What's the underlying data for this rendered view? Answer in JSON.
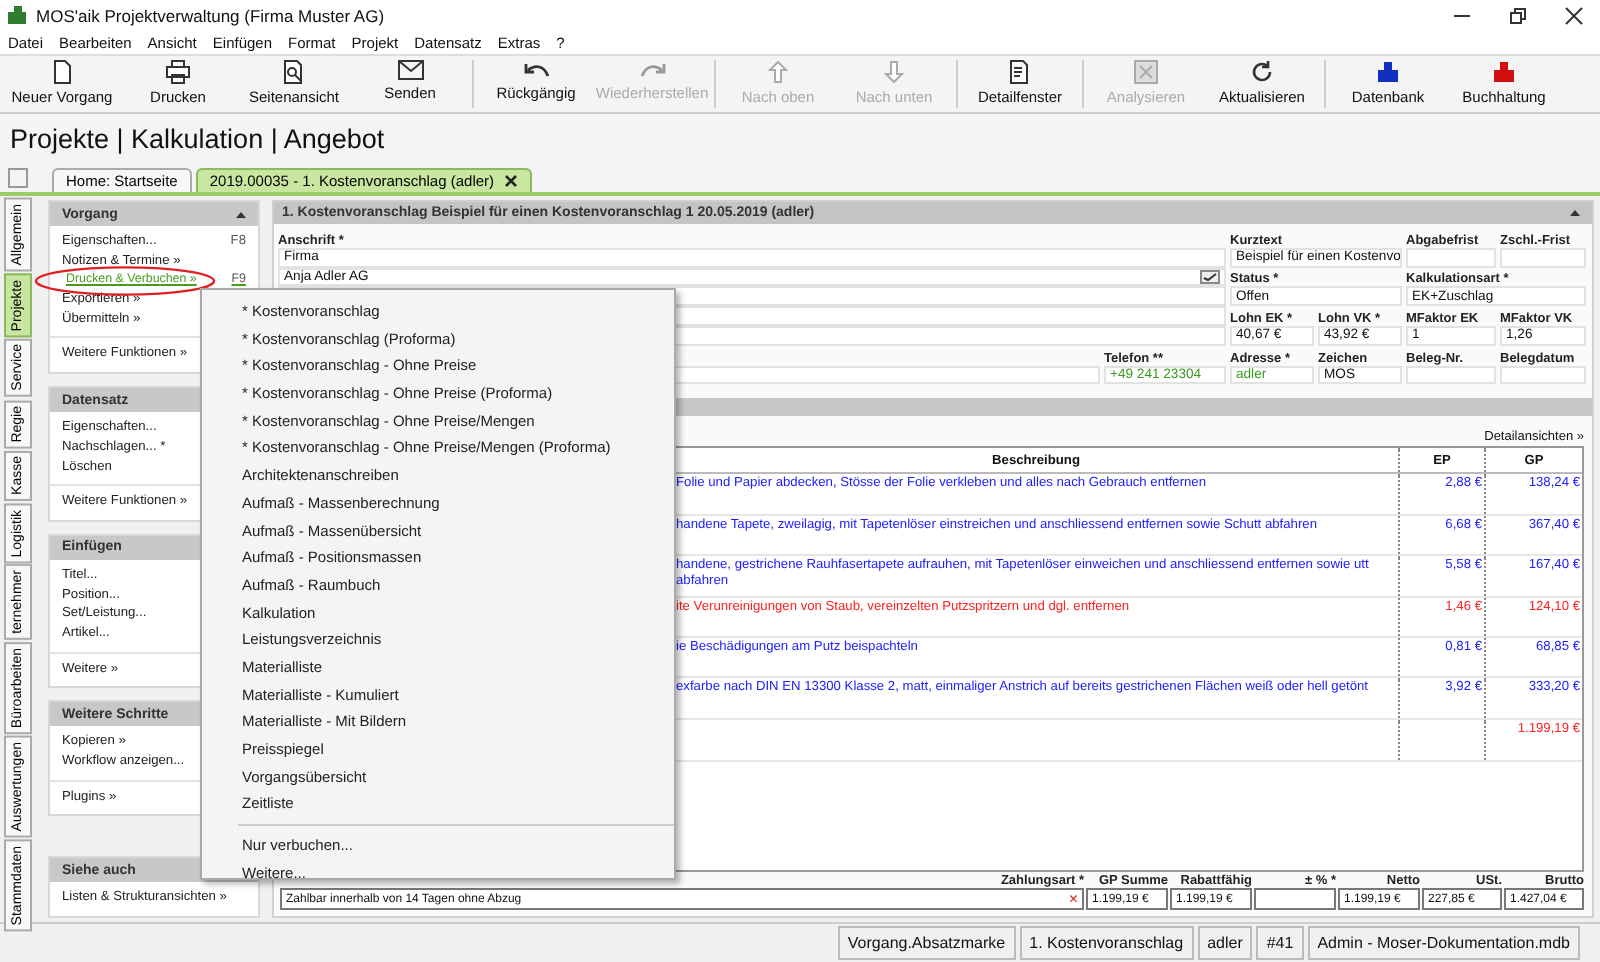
{
  "window": {
    "title": "MOS'aik Projektverwaltung (Firma Muster AG)"
  },
  "menu": [
    "Datei",
    "Bearbeiten",
    "Ansicht",
    "Einfügen",
    "Format",
    "Projekt",
    "Datensatz",
    "Extras",
    "?"
  ],
  "toolbar": [
    {
      "kind": "button",
      "label": "Neuer Vorgang",
      "disabled": false
    },
    {
      "kind": "button",
      "label": "Drucken",
      "disabled": false
    },
    {
      "kind": "button",
      "label": "Seitenansicht",
      "disabled": false
    },
    {
      "kind": "button",
      "label": "Senden",
      "disabled": false
    },
    {
      "kind": "separator"
    },
    {
      "kind": "button",
      "label": "Rückgängig",
      "disabled": false
    },
    {
      "kind": "button",
      "label": "Wiederherstellen",
      "disabled": true
    },
    {
      "kind": "separator"
    },
    {
      "kind": "button",
      "label": "Nach oben",
      "disabled": true
    },
    {
      "kind": "button",
      "label": "Nach unten",
      "disabled": true
    },
    {
      "kind": "separator"
    },
    {
      "kind": "button",
      "label": "Detailfenster",
      "disabled": false
    },
    {
      "kind": "separator"
    },
    {
      "kind": "button",
      "label": "Analysieren",
      "disabled": true
    },
    {
      "kind": "button",
      "label": "Aktualisieren",
      "disabled": false
    },
    {
      "kind": "separator"
    },
    {
      "kind": "button",
      "label": "Datenbank",
      "disabled": false
    },
    {
      "kind": "button",
      "label": "Buchhaltung",
      "disabled": false
    }
  ],
  "breadcrumb": "Projekte | Kalkulation | Angebot",
  "tabs": [
    {
      "label": "Home: Startseite",
      "selected": false
    },
    {
      "label": "2019.00035 - 1. Kostenvoranschlag (adler)",
      "selected": true
    }
  ],
  "side_tabs": [
    {
      "label": "Allgemein",
      "selected": false
    },
    {
      "label": "Projekte",
      "selected": true
    },
    {
      "label": "Service",
      "selected": false
    },
    {
      "label": "Regie",
      "selected": false
    },
    {
      "label": "Kasse",
      "selected": false
    },
    {
      "label": "Logistik",
      "selected": false
    },
    {
      "label": "ternehmer",
      "selected": false
    },
    {
      "label": "Büroarbeiten",
      "selected": false
    },
    {
      "label": "Auswertungen",
      "selected": false
    },
    {
      "label": "Stammdaten",
      "selected": false
    }
  ],
  "sidebar": [
    {
      "title": "Vorgang",
      "collapsible": true,
      "groups": [
        [
          {
            "label": "Eigenschaften...",
            "shortcut": "F8",
            "highlighted": false
          },
          {
            "label": "Notizen & Termine »",
            "highlighted": false
          },
          {
            "label": "Drucken & Verbuchen »",
            "shortcut": "F9",
            "highlighted": true
          },
          {
            "label": "Exportieren »",
            "highlighted": false
          },
          {
            "label": "Übermitteln »",
            "highlighted": false
          }
        ],
        [
          {
            "label": "Weitere Funktionen »",
            "highlighted": false
          }
        ]
      ]
    },
    {
      "title": "Datensatz",
      "collapsible": false,
      "groups": [
        [
          {
            "label": "Eigenschaften...",
            "highlighted": false
          },
          {
            "label": "Nachschlagen... *",
            "highlighted": false
          },
          {
            "label": "Löschen",
            "highlighted": false
          }
        ],
        [
          {
            "label": "Weitere Funktionen »",
            "highlighted": false
          }
        ]
      ]
    },
    {
      "title": "Einfügen",
      "collapsible": false,
      "groups": [
        [
          {
            "label": "Titel...",
            "highlighted": false
          },
          {
            "label": "Position...",
            "highlighted": false
          },
          {
            "label": "Set/Leistung...",
            "highlighted": false
          },
          {
            "label": "Artikel...",
            "highlighted": false
          }
        ],
        [
          {
            "label": "Weitere »",
            "highlighted": false
          }
        ]
      ]
    },
    {
      "title": "Weitere Schritte",
      "collapsible": false,
      "groups": [
        [
          {
            "label": "Kopieren »",
            "highlighted": false
          },
          {
            "label": "Workflow anzeigen...",
            "highlighted": false
          }
        ],
        [
          {
            "label": "Plugins »",
            "highlighted": false
          }
        ]
      ]
    },
    {
      "title": "Siehe auch",
      "groups": [
        [
          {
            "label": "Listen & Strukturansichten »",
            "highlighted": false
          }
        ]
      ]
    }
  ],
  "popup_menu": {
    "groups": [
      [
        "* Kostenvoranschlag",
        "* Kostenvoranschlag (Proforma)",
        "* Kostenvoranschlag - Ohne Preise",
        "* Kostenvoranschlag - Ohne Preise (Proforma)",
        "* Kostenvoranschlag - Ohne Preise/Mengen",
        "* Kostenvoranschlag - Ohne Preise/Mengen (Proforma)",
        "Architektenanschreiben",
        "Aufmaß - Massenberechnung",
        "Aufmaß - Massenübersicht",
        "Aufmaß - Positionsmassen",
        "Aufmaß - Raumbuch",
        "Kalkulation",
        "Leistungsverzeichnis",
        "Materialliste",
        "Materialliste - Kumuliert",
        "Materialliste - Mit Bildern",
        "Preisspiegel",
        "Vorgangsübersicht",
        "Zeitliste"
      ],
      [
        "Nur verbuchen...",
        "Weitere..."
      ]
    ]
  },
  "document": {
    "title": "1. Kostenvoranschlag Beispiel für einen Kostenvoranschlag 1 20.05.2019 (adler)",
    "address_label": "Anschrift *",
    "address_lines": [
      "Firma",
      "Anja Adler AG"
    ],
    "fields": [
      {
        "label": "Kurztext",
        "value": "Beispiel für einen Kostenvo"
      },
      {
        "label": "Abgabefrist"
      },
      {
        "label": "Zschl.-Frist"
      },
      {
        "label": "Status *",
        "value": "Offen"
      },
      {
        "label": "Kalkulationsart *",
        "value": "EK+Zuschlag"
      },
      {
        "label": "Lohn EK *",
        "value": "40,67 €"
      },
      {
        "label": "Lohn VK *",
        "value": "43,92 €"
      },
      {
        "label": "MFaktor EK",
        "value": "1"
      },
      {
        "label": "MFaktor VK",
        "value": "1,26"
      },
      {
        "label": "Telefon **",
        "value": "+49 241 23304"
      },
      {
        "label": "Adresse *",
        "value": "adler"
      },
      {
        "label": "Zeichen",
        "value": "MOS"
      },
      {
        "label": "Beleg-Nr."
      },
      {
        "label": "Belegdatum"
      }
    ]
  },
  "positions": {
    "link": "Detailansichten »",
    "columns": [
      "Beschreibung",
      "EP",
      "GP"
    ],
    "rows": [
      {
        "description": "Folie und Papier abdecken, Stösse der Folie verkleben und alles nach Gebrauch entfernen",
        "ep": "2,88 €",
        "gp": "138,24 €",
        "color": "#2020ff"
      },
      {
        "description": "handene Tapete, zweilagig, mit Tapetenlöser einstreichen und anschliessend entfernen sowie Schutt abfahren",
        "ep": "6,68 €",
        "gp": "367,40 €",
        "color": "#2020ff"
      },
      {
        "description": "handene, gestrichene Rauhfasertapete aufrauhen, mit Tapetenlöser einweichen und anschliessend entfernen sowie utt abfahren",
        "ep": "5,58 €",
        "gp": "167,40 €",
        "color": "#2020ff"
      },
      {
        "description": "ite Verunreinigungen von Staub, vereinzelten Putzspritzern und dgl. entfernen",
        "ep": "1,46 €",
        "gp": "124,10 €",
        "color": "#ff2020"
      },
      {
        "description": "ie Beschädigungen am Putz beispachteln",
        "ep": "0,81 €",
        "gp": "68,85 €",
        "color": "#2020ff"
      },
      {
        "description": "exfarbe nach DIN EN 13300 Klasse 2, matt, einmaliger Anstrich auf bereits gestrichenen Flächen weiß oder hell getönt",
        "ep": "3,92 €",
        "gp": "333,20 €",
        "color": "#2020ff"
      }
    ],
    "total": "1.199,19 €"
  },
  "totals": {
    "payment_label": "Zahlungsart *",
    "payment_value": "Zahlbar innerhalb von 14 Tagen ohne Abzug",
    "clear": "×",
    "fields": [
      {
        "label": "GP Summe",
        "value": "1.199,19 €"
      },
      {
        "label": "Rabattfähig",
        "value": "1.199,19 €"
      },
      {
        "label": "± % *"
      },
      {
        "label": "Netto",
        "value": "1.199,19 €"
      },
      {
        "label": "USt.",
        "value": "227,85 €"
      },
      {
        "label": "Brutto",
        "value": "1.427,04 €"
      }
    ]
  },
  "status_bar": [
    "Vorgang.Absatzmarke",
    "1. Kostenvoranschlag",
    "adler",
    "#41",
    "Admin - Moser-Dokumentation.mdb"
  ]
}
